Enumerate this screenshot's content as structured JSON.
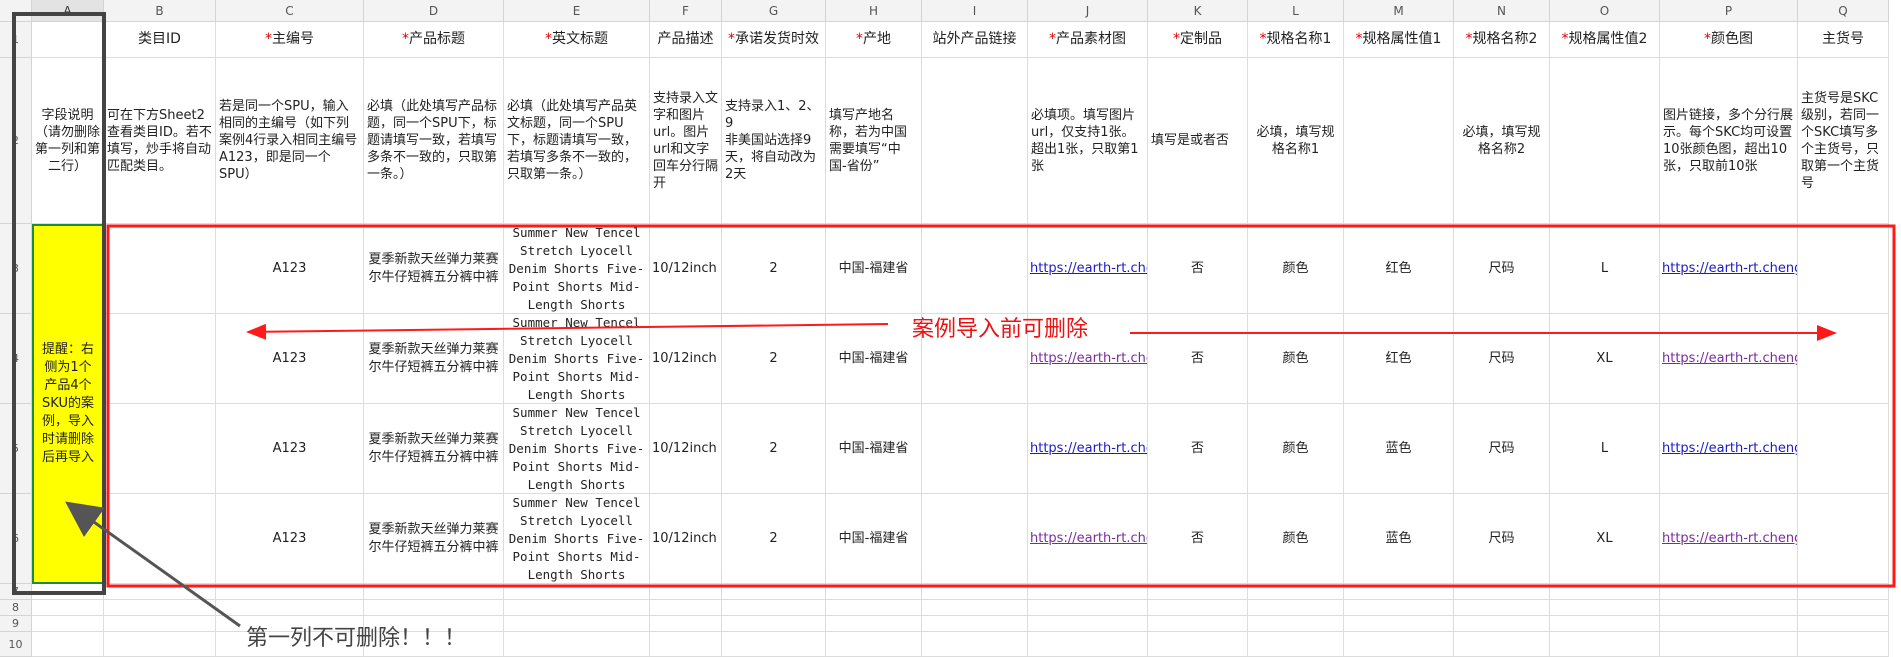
{
  "columns": [
    "A",
    "B",
    "C",
    "D",
    "E",
    "F",
    "G",
    "H",
    "I",
    "J",
    "K",
    "L",
    "M",
    "N",
    "O",
    "P",
    "Q"
  ],
  "rows": [
    "1",
    "2",
    "3",
    "4",
    "5",
    "6",
    "7",
    "8",
    "9",
    "10"
  ],
  "headers": [
    {
      "star": "",
      "text": ""
    },
    {
      "star": "",
      "text": "类目ID"
    },
    {
      "star": "* ",
      "text": "主编号"
    },
    {
      "star": "*",
      "text": "产品标题"
    },
    {
      "star": "*",
      "text": "英文标题"
    },
    {
      "star": "",
      "text": "产品描述"
    },
    {
      "star": "*",
      "text": "承诺发货时效"
    },
    {
      "star": "*",
      "text": "产地"
    },
    {
      "star": "",
      "text": "站外产品链接"
    },
    {
      "star": "* ",
      "text": "产品素材图"
    },
    {
      "star": "*",
      "text": "定制品"
    },
    {
      "star": "* ",
      "text": "规格名称1"
    },
    {
      "star": "* ",
      "text": "规格属性值1"
    },
    {
      "star": "* ",
      "text": "规格名称2"
    },
    {
      "star": "* ",
      "text": "规格属性值2"
    },
    {
      "star": "* ",
      "text": "颜色图"
    },
    {
      "star": "",
      "text": "主货号"
    }
  ],
  "descriptions": [
    "字段说明（请勿删除第一列和第二行）",
    "可在下方Sheet2查看类目ID。若不填写，炒手将自动匹配类目。",
    "若是同一个SPU，输入相同的主编号（如下列案例4行录入相同主编号A123，即是同一个SPU）",
    "必填（此处填写产品标题，同一个SPU下，标题请填写一致，若填写多条不一致的，只取第一条。）",
    "必填（此处填写产品英文标题，同一个SPU下，标题请填写一致，若填写多条不一致的，只取第一条。）",
    "支持录入文字和图片url。图片url和文字回车分行隔开",
    "支持录入1、2、9\n非美国站选择9天，将自动改为2天",
    "填写产地名称，若为中国需要填写“中国-省份”",
    "",
    "必填项。填写图片url，仅支持1张。超出1张，只取第1张",
    "填写是或者否",
    "必填，填写规格名称1",
    "",
    "必填，填写规格名称2",
    "",
    "图片链接，多个分行展示。每个SKC均可设置10张颜色图，超出10张，只取前10张",
    "主货号是SKC级别，若同一个SKC填写多个主货号，只取第一个主货号"
  ],
  "reminder": "提醒：右侧为1个产品4个SKU的案例，导入时请删除后再导入",
  "examples": [
    {
      "code": "A123",
      "title_cn": "夏季新款天丝弹力莱赛尔牛仔短裤五分裤中裤",
      "title_en": "Summer New Tencel Stretch Lyocell Denim Shorts Five-Point Shorts Mid-Length Shorts",
      "desc": "10/12inch",
      "ship": "2",
      "origin": "中国-福建省",
      "img": "https://earth-rt.chengji-inc.com",
      "custom": "否",
      "spec1": "颜色",
      "val1": "红色",
      "spec2": "尺码",
      "val2": "L",
      "color_img": "https://earth-rt.chengji-inc.com"
    },
    {
      "code": "A123",
      "title_cn": "夏季新款天丝弹力莱赛尔牛仔短裤五分裤中裤",
      "title_en": "Summer New Tencel Stretch Lyocell Denim Shorts Five-Point Shorts Mid-Length Shorts",
      "desc": "10/12inch",
      "ship": "2",
      "origin": "中国-福建省",
      "img": "https://earth-rt.chengji-inc.com",
      "custom": "否",
      "spec1": "颜色",
      "val1": "红色",
      "spec2": "尺码",
      "val2": "XL",
      "color_img": "https://earth-rt.chengji-inc.com"
    },
    {
      "code": "A123",
      "title_cn": "夏季新款天丝弹力莱赛尔牛仔短裤五分裤中裤",
      "title_en": "Summer New Tencel Stretch Lyocell Denim Shorts Five-Point Shorts Mid-Length Shorts",
      "desc": "10/12inch",
      "ship": "2",
      "origin": "中国-福建省",
      "img": "https://earth-rt.chengji-inc.com",
      "custom": "否",
      "spec1": "颜色",
      "val1": "蓝色",
      "spec2": "尺码",
      "val2": "L",
      "color_img": "https://earth-rt.chengji-inc.com"
    },
    {
      "code": "A123",
      "title_cn": "夏季新款天丝弹力莱赛尔牛仔短裤五分裤中裤",
      "title_en": "Summer New Tencel Stretch Lyocell Denim Shorts Five-Point Shorts Mid-Length Shorts",
      "desc": "10/12inch",
      "ship": "2",
      "origin": "中国-福建省",
      "img": "https://earth-rt.chengji-inc.com",
      "custom": "否",
      "spec1": "颜色",
      "val1": "蓝色",
      "spec2": "尺码",
      "val2": "XL",
      "color_img": "https://earth-rt.chengji-inc.com"
    }
  ],
  "annotations": {
    "delete_hint": "案例导入前可删除",
    "keep_first_column": "第一列不可删除！！！"
  },
  "colors": {
    "annotation_red": "#ff1a1a",
    "reminder_bg": "#ffff00",
    "annotation_gray": "#555555"
  }
}
